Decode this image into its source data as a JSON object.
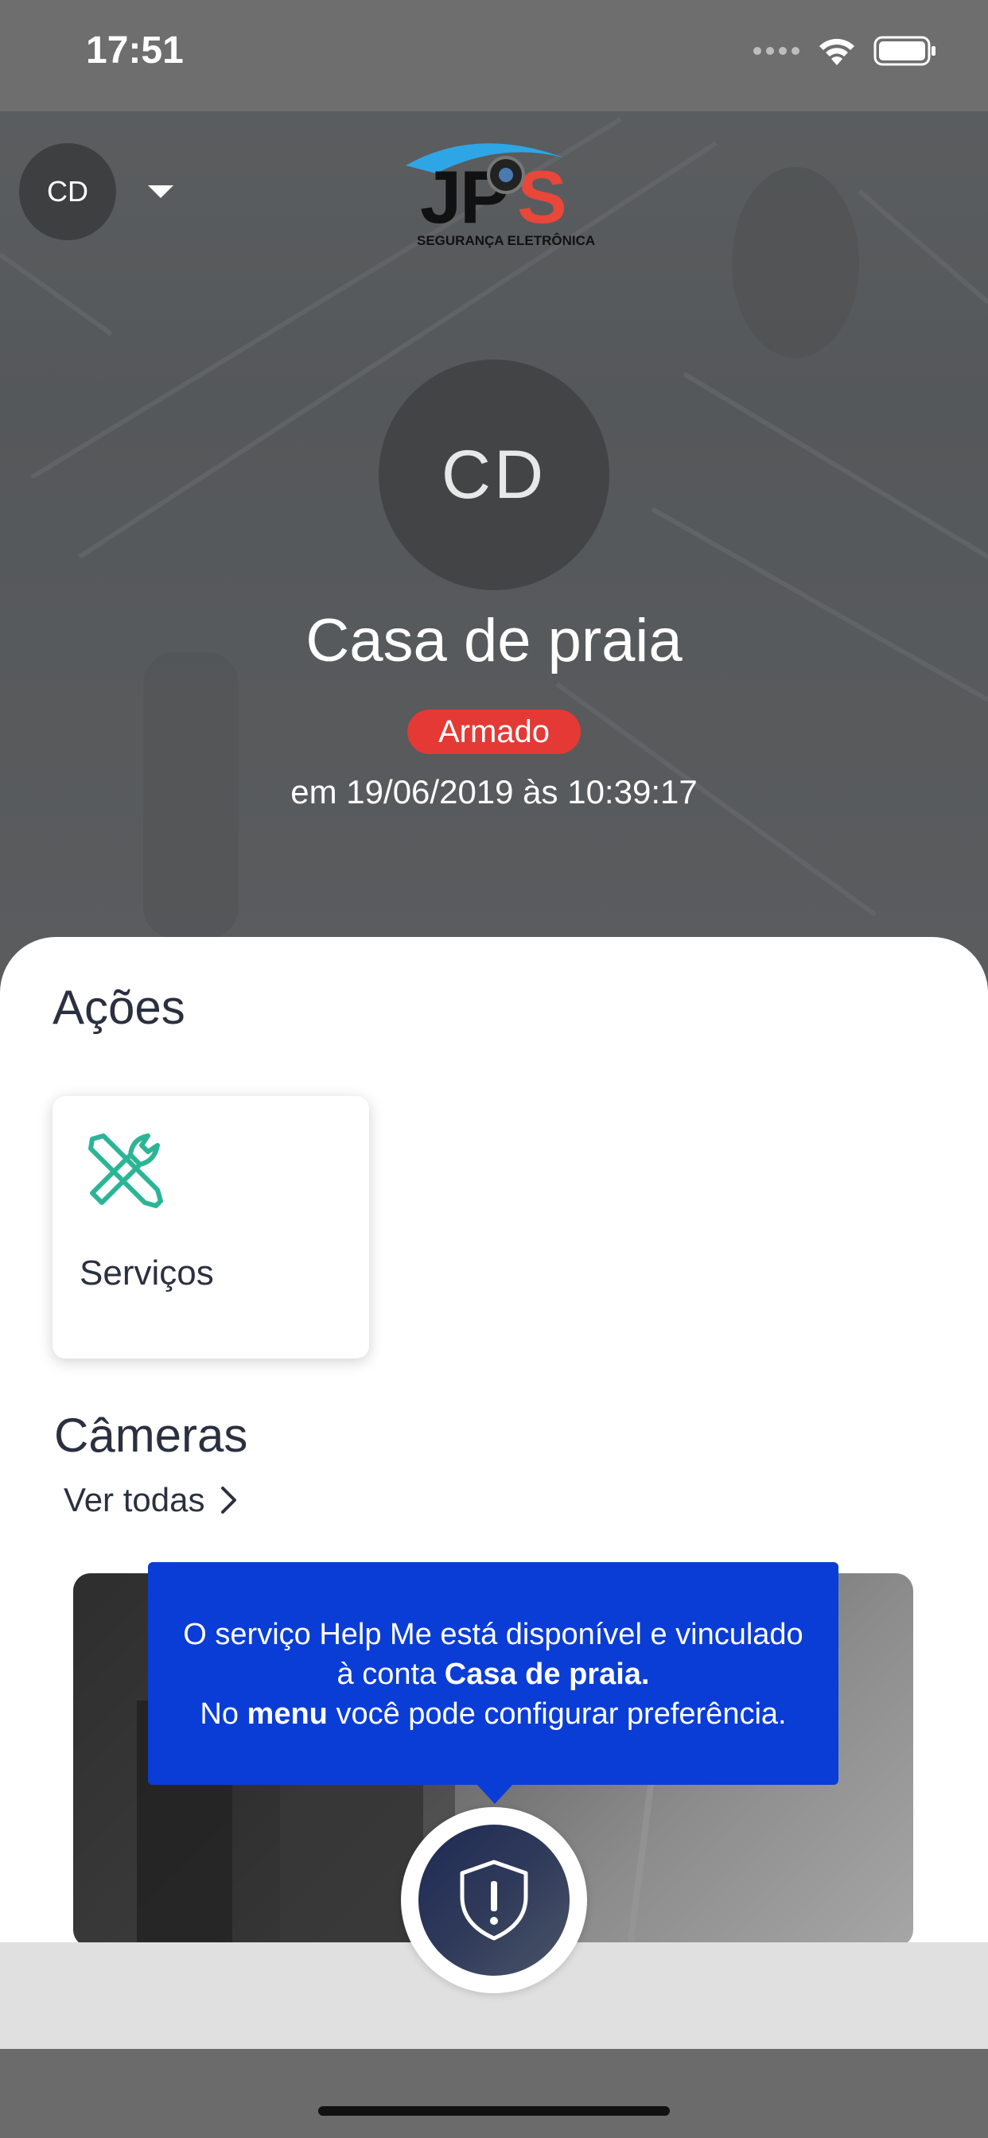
{
  "status_bar": {
    "time": "17:51"
  },
  "header": {
    "account_initials": "CD",
    "logo": {
      "brand": "JPS",
      "tagline": "SEGURANÇA ELETRÔNICA"
    }
  },
  "profile": {
    "initials": "CD",
    "name": "Casa de praia",
    "status": "Armado",
    "status_color": "#e53935",
    "status_date": "em 19/06/2019 às 10:39:17"
  },
  "actions": {
    "title": "Ações",
    "items": [
      {
        "label": "Serviços",
        "icon": "tools-icon",
        "icon_color": "#2bb596"
      }
    ]
  },
  "cameras": {
    "title": "Câmeras",
    "see_all": "Ver todas"
  },
  "tooltip": {
    "line1": "O serviço Help Me está disponível e vinculado",
    "line2_prefix": "à conta ",
    "line2_bold": "Casa de praia.",
    "line3_prefix": "No ",
    "line3_bold": "menu",
    "line3_suffix": " você pode configurar preferência.",
    "bg_color": "#0a3dd6"
  },
  "help_button": {
    "icon": "shield-alert-icon"
  }
}
